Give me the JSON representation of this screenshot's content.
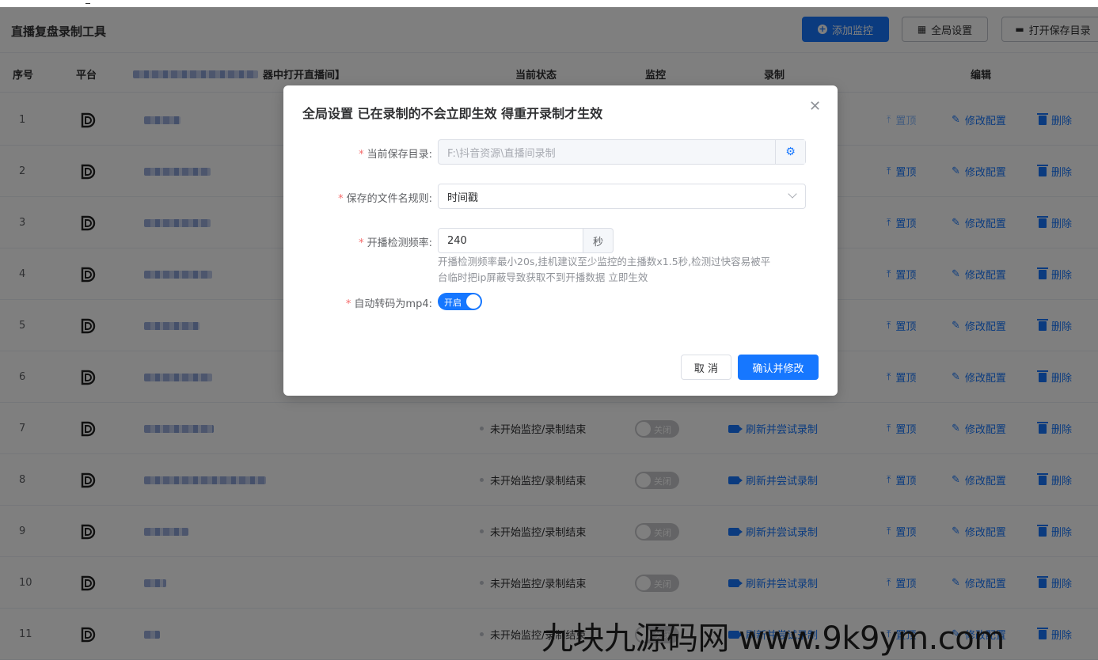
{
  "header": {
    "title": "直播复盘录制工具",
    "buttons": {
      "add_monitor": "添加监控",
      "global_settings": "全局设置",
      "open_save_dir": "打开保存目录"
    }
  },
  "table": {
    "columns": {
      "index": "序号",
      "platform": "平台",
      "address_suffix": "器中打开直播间】",
      "status": "当前状态",
      "monitor": "监控",
      "record": "录制",
      "edit": "编辑"
    },
    "rows": [
      {
        "index": "1"
      },
      {
        "index": "2"
      },
      {
        "index": "3"
      },
      {
        "index": "4"
      },
      {
        "index": "5"
      },
      {
        "index": "6"
      },
      {
        "index": "7",
        "status": "未开始监控/录制结束",
        "monitor": "关闭",
        "record": "刷新并尝试录制"
      },
      {
        "index": "8",
        "status": "未开始监控/录制结束",
        "monitor": "关闭",
        "record": "刷新并尝试录制"
      },
      {
        "index": "9",
        "status": "未开始监控/录制结束",
        "monitor": "关闭",
        "record": "刷新并尝试录制"
      },
      {
        "index": "10",
        "status": "未开始监控/录制结束",
        "monitor": "关闭",
        "record": "刷新并尝试录制"
      },
      {
        "index": "11",
        "status": "未开始监控/录制结束",
        "monitor": "关闭",
        "record": "刷新并尝试录制"
      }
    ],
    "actions": {
      "top": "置顶",
      "edit": "修改配置",
      "delete": "删除"
    }
  },
  "dialog": {
    "title": "全局设置 已在录制的不会立即生效 得重开录制才生效",
    "save_dir": {
      "label": "当前保存目录:",
      "placeholder": "F:\\抖音资源\\直播间录制"
    },
    "filename_rule": {
      "label": "保存的文件名规则:",
      "value": "时间戳"
    },
    "check_freq": {
      "label": "开播检测频率:",
      "value": "240",
      "unit": "秒",
      "hint_line1": "开播检测频率最小20s,挂机建议至少监控的主播数x1.5秒,检测过快容易被平",
      "hint_line2": "台临时把ip屏蔽导致获取不到开播数据 立即生效"
    },
    "auto_mp4": {
      "label": "自动转码为mp4:",
      "state": "开启"
    },
    "cancel": "取 消",
    "confirm": "确认并修改"
  },
  "watermark": "九块九源码网 www.9k9ym.com",
  "colors": {
    "primary": "#1677ff",
    "required": "#f56c6c",
    "switch_off": "#c8c9cc"
  }
}
